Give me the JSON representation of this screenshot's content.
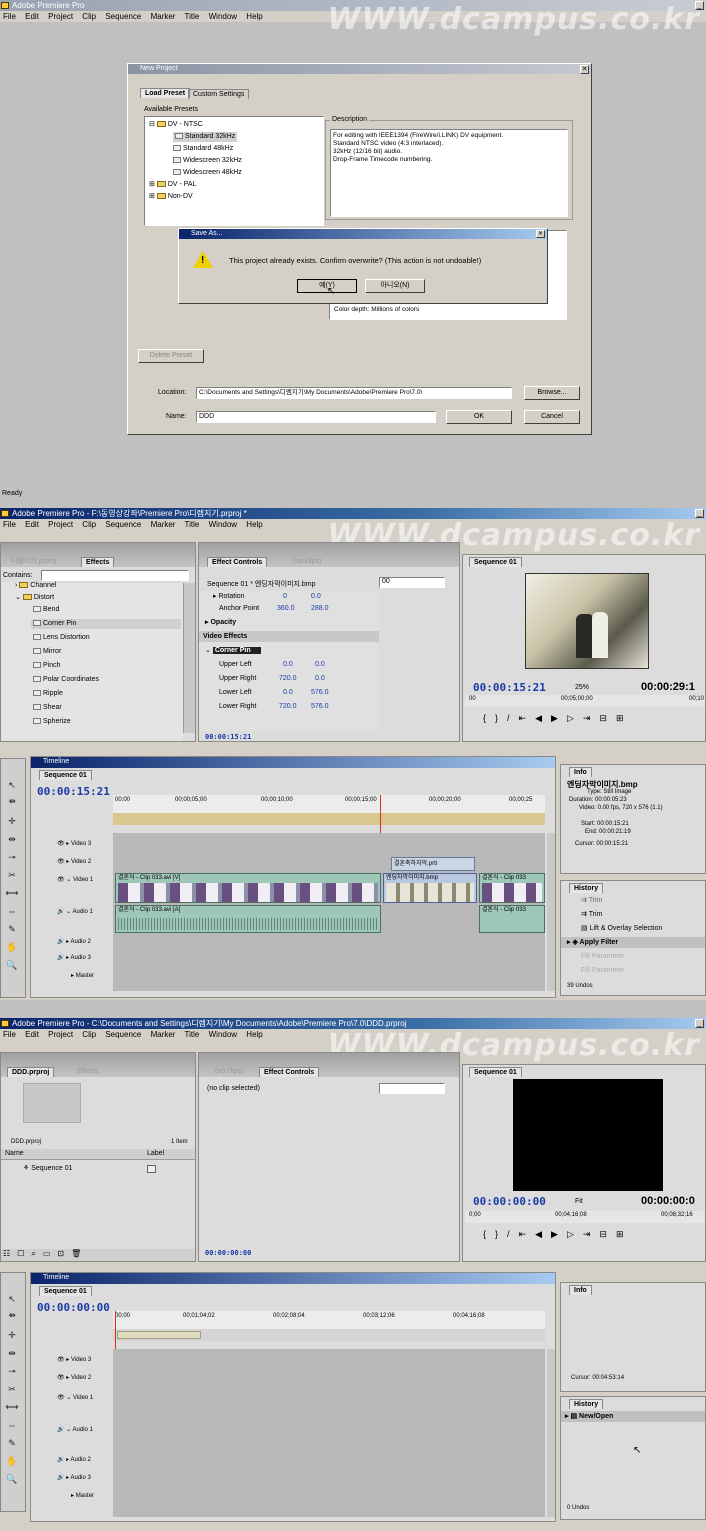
{
  "watermark": "WWW.dcampus.co.kr",
  "screen1": {
    "app_title": "Adobe Premiere Pro",
    "menu": [
      "File",
      "Edit",
      "Project",
      "Clip",
      "Sequence",
      "Marker",
      "Title",
      "Window",
      "Help"
    ],
    "dialog": {
      "title": "New Project",
      "tabs": [
        "Load Preset",
        "Custom Settings"
      ],
      "presets_label": "Available Presets",
      "tree": [
        {
          "label": "DV - NTSC",
          "level": 0,
          "expanded": true
        },
        {
          "label": "Standard 32kHz",
          "level": 1,
          "selected": true
        },
        {
          "label": "Standard 48kHz",
          "level": 1
        },
        {
          "label": "Widescreen 32kHz",
          "level": 1
        },
        {
          "label": "Widescreen 48kHz",
          "level": 1
        },
        {
          "label": "DV - PAL",
          "level": 0
        },
        {
          "label": "Non-DV",
          "level": 0
        }
      ],
      "description_label": "Description",
      "description_lines": [
        "For editing with IEEE1394 (FireWire/i.LINK) DV equipment.",
        "Standard NTSC video (4:3 interlaced).",
        "32kHz (12/16 bit) audio.",
        "Drop-Frame Timecode numbering."
      ],
      "color_depth": "Color depth: Millions of colors",
      "delete_preset": "Delete Preset",
      "location_label": "Location:",
      "location_value": "C:\\Documents and Settings\\디렘지기\\My Documents\\Adobe\\Premiere Pro\\7.0\\",
      "browse": "Browse...",
      "name_label": "Name:",
      "name_value": "DDD",
      "ok": "OK",
      "cancel": "Cancel"
    },
    "save_as": {
      "title": "Save As...",
      "message": "This project already exists.  Confirm overwrite? (This action is not undoable!)",
      "yes": "예(Y)",
      "no": "아니오(N)"
    },
    "status": "Ready"
  },
  "screen2": {
    "app_title": "Adobe Premiere Pro - F:\\동영상강좌\\Premiere Pro\\디렘지기.prproj *",
    "menu": [
      "File",
      "Edit",
      "Project",
      "Clip",
      "Sequence",
      "Marker",
      "Title",
      "Window",
      "Help"
    ],
    "left_tabs": [
      "디렘지기.prproj",
      "Effects"
    ],
    "contains_label": "Contains:",
    "effects": [
      {
        "label": "Channel",
        "type": "folder"
      },
      {
        "label": "Distort",
        "type": "folder"
      },
      {
        "label": "Bend",
        "type": "fx"
      },
      {
        "label": "Corner Pin",
        "type": "fx",
        "selected": true
      },
      {
        "label": "Lens Distortion",
        "type": "fx"
      },
      {
        "label": "Mirror",
        "type": "fx"
      },
      {
        "label": "Pinch",
        "type": "fx"
      },
      {
        "label": "Polar Coordinates",
        "type": "fx"
      },
      {
        "label": "Ripple",
        "type": "fx"
      },
      {
        "label": "Shear",
        "type": "fx"
      },
      {
        "label": "Spherize",
        "type": "fx"
      }
    ],
    "monitor_tabs": [
      "Effect Controls",
      "(no clips)"
    ],
    "ec_header": "Sequence 01 * 엔딩자막이미지.bmp",
    "ec_time": "00",
    "ec_rows": [
      {
        "label": "Rotation",
        "v1": "0",
        "v2": "0.0"
      },
      {
        "label": "Anchor Point",
        "v1": "360.0",
        "v2": "288.0"
      },
      {
        "label": "Opacity",
        "v1": "",
        "v2": ""
      },
      {
        "label": "Video Effects",
        "v1": "",
        "v2": ""
      },
      {
        "label": "Corner Pin",
        "v1": "",
        "v2": ""
      },
      {
        "label": "Upper Left",
        "v1": "0.0",
        "v2": "0.0"
      },
      {
        "label": "Upper Right",
        "v1": "720.0",
        "v2": "0.0"
      },
      {
        "label": "Lower Left",
        "v1": "0.0",
        "v2": "576.0"
      },
      {
        "label": "Lower Right",
        "v1": "720.0",
        "v2": "576.0"
      }
    ],
    "ec_footer_tc": "00:00:15:21",
    "program_tab": "Sequence 01",
    "program_tc": "00:00:15:21",
    "program_zoom": "25%",
    "program_duration": "00:00:29:1",
    "program_ruler": [
      "00",
      "00;05;00;00",
      "00;10"
    ],
    "timeline_title": "Timeline",
    "timeline_tab": "Sequence 01",
    "timeline_tc": "00:00:15:21",
    "ruler_labels": [
      "00;00",
      "00;00;05;00",
      "00;00;10;00",
      "00;00;15;00",
      "00;00;20;00",
      "00;00;25"
    ],
    "tracks": [
      "Video 3",
      "Video 2",
      "Video 1",
      "Audio 1",
      "Audio 2",
      "Audio 3",
      "Master"
    ],
    "clips": {
      "v2": "결혼축하자막.prtl",
      "v1a": "결혼식 - Clip 033.avi [V]",
      "v1b": "엔딩자막이미지.bmp",
      "v1c": "결혼식 - Clip 033",
      "a1a": "결혼식 - Clip 033.avi [A]",
      "a1b": "결혼식 - Clip 033"
    },
    "info_tab": "Info",
    "info_name": "엔딩자막이미지.bmp",
    "info_lines": [
      "Type: Still Image",
      "Duration: 00:00:05:23",
      "Video: 0.00 fps, 720 x 576 (1.1)",
      "Start: 00:00:15:21",
      "End: 00:00:21:19",
      "Cursor: 00:00:15:21"
    ],
    "history_tab": "History",
    "history": [
      "Trim",
      "Trim",
      "Lift & Overlay Selection",
      "Apply Filter",
      "Fill Parameter",
      "Fill Parameter"
    ],
    "undos": "39 Undos"
  },
  "screen3": {
    "app_title": "Adobe Premiere Pro - C:\\Documents and Settings\\디렘지기\\My Documents\\Adobe\\Premiere Pro\\7.0\\DDD.prproj",
    "menu": [
      "File",
      "Edit",
      "Project",
      "Clip",
      "Sequence",
      "Marker",
      "Title",
      "Window",
      "Help"
    ],
    "project_tabs": [
      "DDD.prproj",
      "Effects"
    ],
    "project_file": "DDD.prproj",
    "item_count": "1 Item",
    "col_name": "Name",
    "col_label": "Label",
    "sequence_item": "Sequence 01",
    "monitor_tabs": [
      "(no clips)",
      "Effect Controls"
    ],
    "no_clip": "(no clip selected)",
    "ec_footer_tc": "00:00:00:00",
    "program_tab": "Sequence 01",
    "program_tc": "00:00:00:00",
    "program_zoom": "Fit",
    "program_duration": "00:00:00:0",
    "program_ruler": [
      "0;00",
      "00;04;16;08",
      "00;08;32;16"
    ],
    "timeline_title": "Timeline",
    "timeline_tab": "Sequence 01",
    "timeline_tc": "00:00:00:00",
    "ruler_labels": [
      "00;00",
      "00;01;04;02",
      "00;02;08;04",
      "00;03;12;06",
      "00;04;16;08"
    ],
    "tracks": [
      "Video 3",
      "Video 2",
      "Video 1",
      "Audio 1",
      "Audio 2",
      "Audio 3",
      "Master"
    ],
    "info_tab": "Info",
    "info_cursor": "Cursor: 00:04:53:14",
    "history_tab": "History",
    "history": [
      "New/Open"
    ],
    "undos": "0 Undos"
  }
}
